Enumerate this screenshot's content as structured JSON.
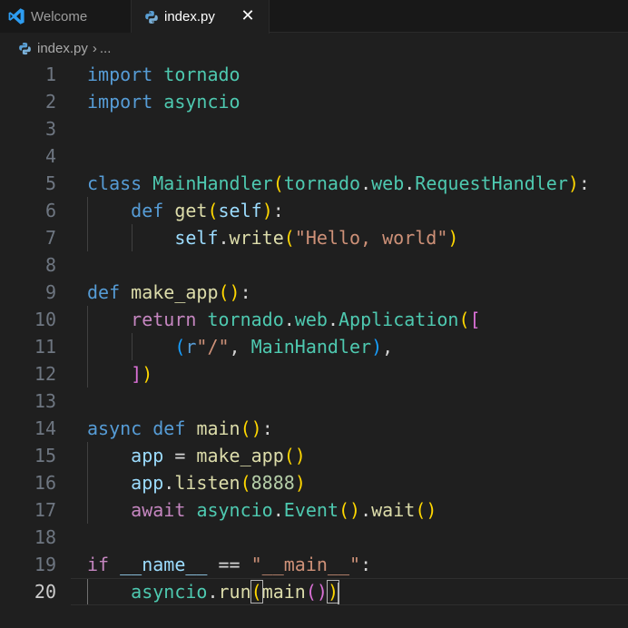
{
  "tabs": [
    {
      "label": "Welcome",
      "icon": "vscode-icon",
      "active": false
    },
    {
      "label": "index.py",
      "icon": "python-file-icon",
      "active": true,
      "close": "✕"
    }
  ],
  "breadcrumb": {
    "file": "index.py",
    "separator": "›",
    "more": "..."
  },
  "colors": {
    "keyword": "#569cd6",
    "control": "#c586c0",
    "function": "#dcdcaa",
    "class": "#4ec9b0",
    "variable": "#9cdcfe",
    "string": "#ce9178",
    "number": "#b5cea8",
    "bracket1": "#ffd700",
    "bracket2": "#da70d6",
    "bracket3": "#179fff",
    "background": "#1f1f1f"
  },
  "editor": {
    "current_line": 20,
    "lines": [
      {
        "n": "1",
        "t": [
          [
            "kw",
            "import"
          ],
          [
            "op",
            " "
          ],
          [
            "mod",
            "tornado"
          ]
        ]
      },
      {
        "n": "2",
        "t": [
          [
            "kw",
            "import"
          ],
          [
            "op",
            " "
          ],
          [
            "mod",
            "asyncio"
          ]
        ]
      },
      {
        "n": "3",
        "t": []
      },
      {
        "n": "4",
        "t": []
      },
      {
        "n": "5",
        "t": [
          [
            "kw",
            "class"
          ],
          [
            "op",
            " "
          ],
          [
            "cls",
            "MainHandler"
          ],
          [
            "p1",
            "("
          ],
          [
            "mod",
            "tornado"
          ],
          [
            "op",
            "."
          ],
          [
            "mod",
            "web"
          ],
          [
            "op",
            "."
          ],
          [
            "cls",
            "RequestHandler"
          ],
          [
            "p1",
            ")"
          ],
          [
            "op",
            ":"
          ]
        ]
      },
      {
        "n": "6",
        "g": 1,
        "t": [
          [
            "op",
            "    "
          ],
          [
            "kw",
            "def"
          ],
          [
            "op",
            " "
          ],
          [
            "fn",
            "get"
          ],
          [
            "p1",
            "("
          ],
          [
            "var",
            "self"
          ],
          [
            "p1",
            ")"
          ],
          [
            "op",
            ":"
          ]
        ]
      },
      {
        "n": "7",
        "g": 2,
        "t": [
          [
            "op",
            "        "
          ],
          [
            "var",
            "self"
          ],
          [
            "op",
            "."
          ],
          [
            "fn",
            "write"
          ],
          [
            "p1",
            "("
          ],
          [
            "str",
            "\"Hello, world\""
          ],
          [
            "p1",
            ")"
          ]
        ]
      },
      {
        "n": "8",
        "t": []
      },
      {
        "n": "9",
        "t": [
          [
            "kw",
            "def"
          ],
          [
            "op",
            " "
          ],
          [
            "fn",
            "make_app"
          ],
          [
            "p1",
            "()"
          ],
          [
            "op",
            ":"
          ]
        ]
      },
      {
        "n": "10",
        "g": 1,
        "t": [
          [
            "op",
            "    "
          ],
          [
            "ctl",
            "return"
          ],
          [
            "op",
            " "
          ],
          [
            "mod",
            "tornado"
          ],
          [
            "op",
            "."
          ],
          [
            "mod",
            "web"
          ],
          [
            "op",
            "."
          ],
          [
            "cls",
            "Application"
          ],
          [
            "p1",
            "("
          ],
          [
            "p2",
            "["
          ]
        ]
      },
      {
        "n": "11",
        "g": 2,
        "t": [
          [
            "op",
            "        "
          ],
          [
            "p3",
            "("
          ],
          [
            "kw",
            "r"
          ],
          [
            "str",
            "\"/\""
          ],
          [
            "op",
            ", "
          ],
          [
            "cls",
            "MainHandler"
          ],
          [
            "p3",
            ")"
          ],
          [
            "op",
            ","
          ]
        ]
      },
      {
        "n": "12",
        "g": 1,
        "t": [
          [
            "op",
            "    "
          ],
          [
            "p2",
            "]"
          ],
          [
            "p1",
            ")"
          ]
        ]
      },
      {
        "n": "13",
        "t": []
      },
      {
        "n": "14",
        "t": [
          [
            "kw",
            "async"
          ],
          [
            "op",
            " "
          ],
          [
            "kw",
            "def"
          ],
          [
            "op",
            " "
          ],
          [
            "fn",
            "main"
          ],
          [
            "p1",
            "()"
          ],
          [
            "op",
            ":"
          ]
        ]
      },
      {
        "n": "15",
        "g": 1,
        "t": [
          [
            "op",
            "    "
          ],
          [
            "var",
            "app"
          ],
          [
            "op",
            " = "
          ],
          [
            "fn",
            "make_app"
          ],
          [
            "p1",
            "()"
          ]
        ]
      },
      {
        "n": "16",
        "g": 1,
        "t": [
          [
            "op",
            "    "
          ],
          [
            "var",
            "app"
          ],
          [
            "op",
            "."
          ],
          [
            "fn",
            "listen"
          ],
          [
            "p1",
            "("
          ],
          [
            "num",
            "8888"
          ],
          [
            "p1",
            ")"
          ]
        ]
      },
      {
        "n": "17",
        "g": 1,
        "t": [
          [
            "op",
            "    "
          ],
          [
            "ctl",
            "await"
          ],
          [
            "op",
            " "
          ],
          [
            "mod",
            "asyncio"
          ],
          [
            "op",
            "."
          ],
          [
            "cls",
            "Event"
          ],
          [
            "p1",
            "()"
          ],
          [
            "op",
            "."
          ],
          [
            "fn",
            "wait"
          ],
          [
            "p1",
            "()"
          ]
        ]
      },
      {
        "n": "18",
        "t": []
      },
      {
        "n": "19",
        "t": [
          [
            "ctl",
            "if"
          ],
          [
            "op",
            " "
          ],
          [
            "var",
            "__name__"
          ],
          [
            "op",
            " == "
          ],
          [
            "str",
            "\"__main__\""
          ],
          [
            "op",
            ":"
          ]
        ]
      },
      {
        "n": "20",
        "g": 1,
        "active_guide": true,
        "t": [
          [
            "op",
            "    "
          ],
          [
            "mod",
            "asyncio"
          ],
          [
            "op",
            "."
          ],
          [
            "fn",
            "run"
          ],
          [
            "p1bm",
            "("
          ],
          [
            "fn",
            "main"
          ],
          [
            "p2",
            "()"
          ],
          [
            "p1bm",
            ")"
          ],
          [
            "cursor",
            ""
          ]
        ]
      }
    ]
  }
}
